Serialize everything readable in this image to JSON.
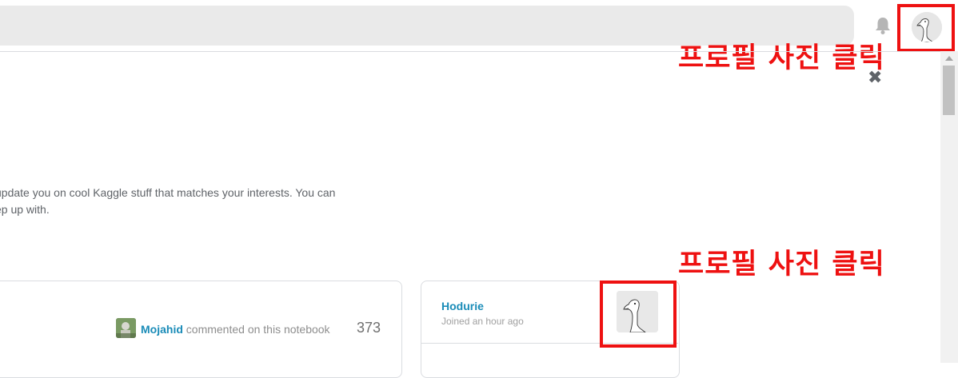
{
  "header": {
    "search_placeholder": "",
    "notifications_icon": "bell-icon",
    "profile_avatar_icon": "goose-avatar-icon"
  },
  "annotations": {
    "top_label": "프로필 사진 클릭",
    "card_label": "프로필 사진 클릭",
    "highlight_color": "#ee1111"
  },
  "banner": {
    "close_icon": "close-icon",
    "close_glyph": "✖",
    "line1": "update you on cool Kaggle stuff that matches your interests. You can",
    "line2": "ep up with."
  },
  "feed": {
    "activity": {
      "user": "Mojahid",
      "action": " commented on this notebook",
      "count": "373"
    }
  },
  "profile_card": {
    "username": "Hodurie",
    "joined": "Joined an hour ago"
  },
  "colors": {
    "link": "#1a8cb8",
    "border": "#dadce0",
    "search_bg": "#eaeaea"
  }
}
